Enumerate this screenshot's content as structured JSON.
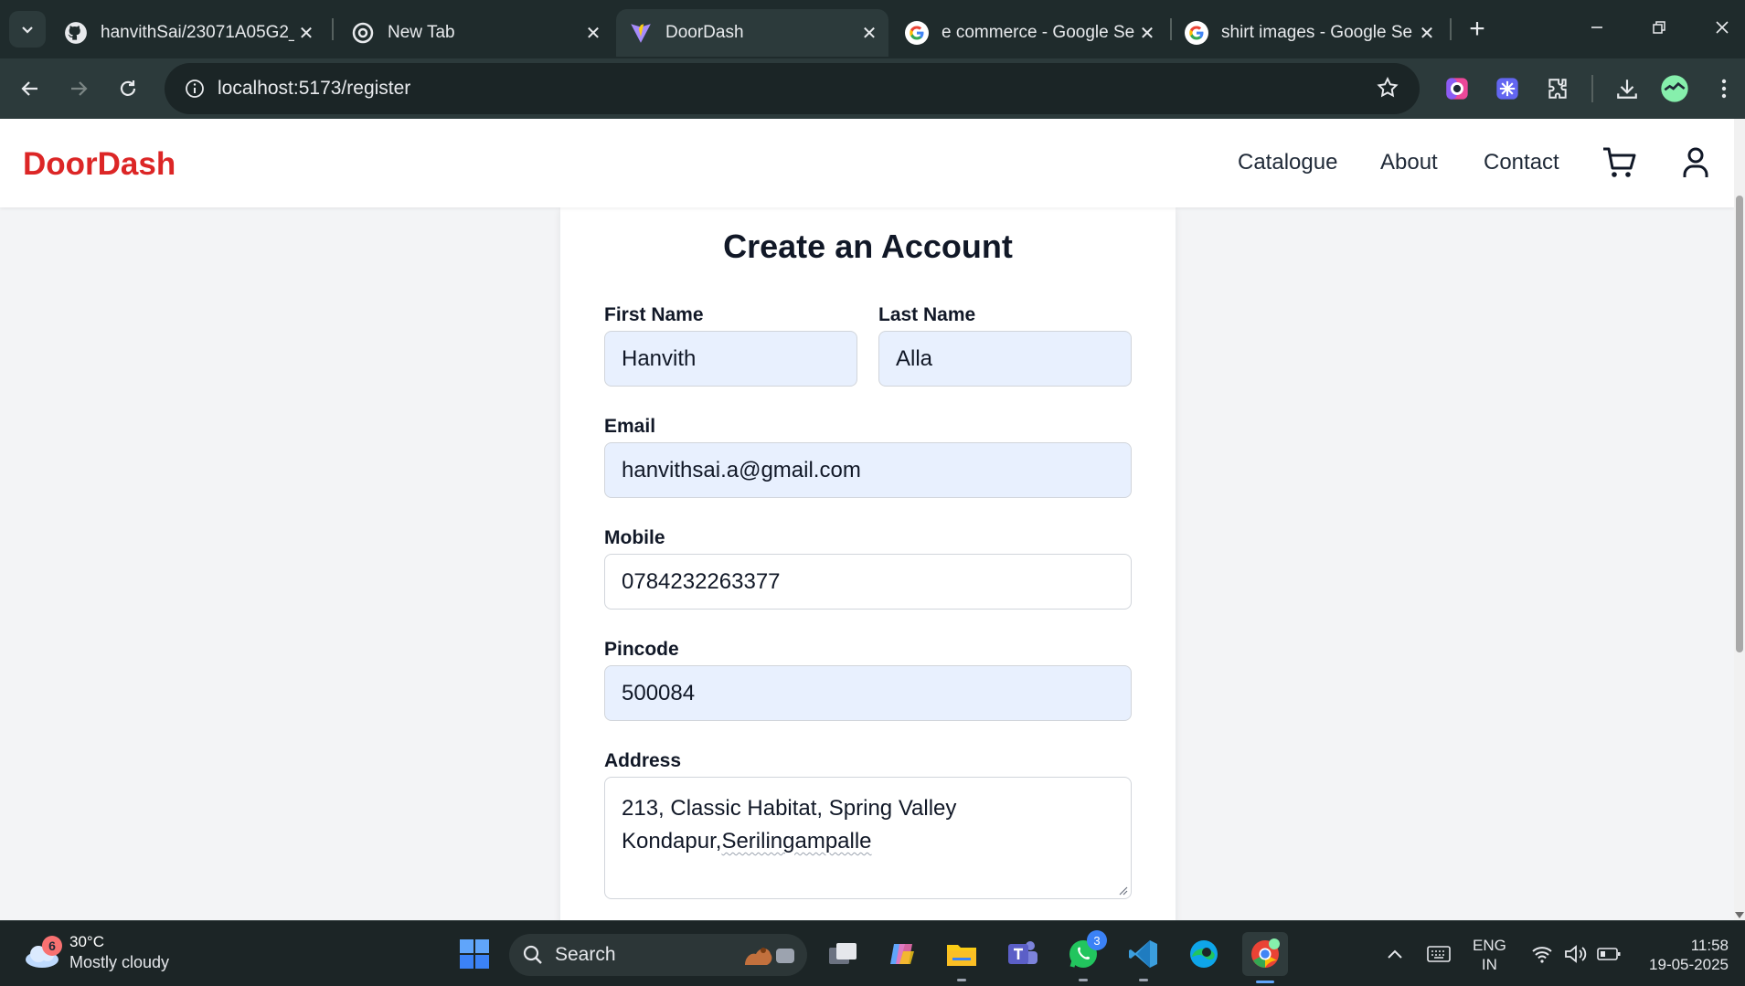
{
  "browser": {
    "tabs": [
      {
        "label": "hanvithSai/23071A05G2_",
        "icon": "github-icon"
      },
      {
        "label": "New Tab",
        "icon": "chrome-icon"
      },
      {
        "label": "DoorDash",
        "icon": "vite-icon",
        "active": true
      },
      {
        "label": "e commerce - Google Se",
        "icon": "google-icon"
      },
      {
        "label": "shirt images - Google Se",
        "icon": "google-icon"
      }
    ],
    "url": "localhost:5173/register"
  },
  "site": {
    "brand": "DoorDash",
    "brand_color": "#dc2626",
    "nav": [
      "Catalogue",
      "About",
      "Contact"
    ]
  },
  "form": {
    "title": "Create an Account",
    "first_name_label": "First Name",
    "first_name_value": "Hanvith",
    "last_name_label": "Last Name",
    "last_name_value": "Alla",
    "email_label": "Email",
    "email_value": "hanvithsai.a@gmail.com",
    "mobile_label": "Mobile",
    "mobile_value": "0784232263377",
    "pincode_label": "Pincode",
    "pincode_value": "500084",
    "address_label": "Address",
    "address_line1": "213, Classic Habitat, Spring Valley",
    "address_line2_a": "Kondapur,",
    "address_line2_b": "Serilingampalle"
  },
  "taskbar": {
    "weather_badge": "6",
    "temperature": "30°C",
    "condition": "Mostly cloudy",
    "search_label": "Search",
    "whatsapp_badge": "3",
    "lang_top": "ENG",
    "lang_bottom": "IN",
    "time": "11:58",
    "date": "19-05-2025"
  }
}
